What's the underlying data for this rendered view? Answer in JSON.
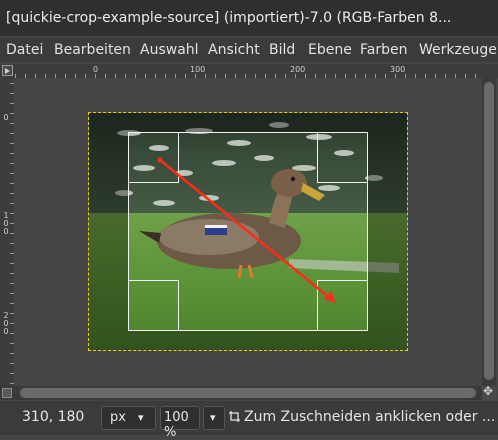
{
  "window": {
    "title": "[quickie-crop-example-source] (importiert)-7.0 (RGB-Farben 8..."
  },
  "menu": {
    "items": [
      "Datei",
      "Bearbeiten",
      "Auswahl",
      "Ansicht",
      "Bild",
      "Ebene",
      "Farben",
      "Werkzeuge"
    ]
  },
  "ruler": {
    "h_labels": [
      "0",
      "100",
      "200",
      "300"
    ],
    "v_labels": [
      "0",
      "100",
      "200"
    ]
  },
  "canvas": {
    "image_alt": "Mallard duck on grass near water",
    "colors": {
      "crop_frame": "#f2f2f2",
      "layer_boundary": "#e8d200",
      "arrow": "#ff2a1a"
    }
  },
  "status": {
    "coords": "310, 180",
    "unit": "px",
    "zoom": "100 %",
    "hint": "Zum Zuschneiden anklicken oder ..."
  },
  "icons": {
    "ruler_corner": "triangle-right-icon",
    "navigate": "navigate-icon",
    "crop_hint": "crop-icon"
  }
}
